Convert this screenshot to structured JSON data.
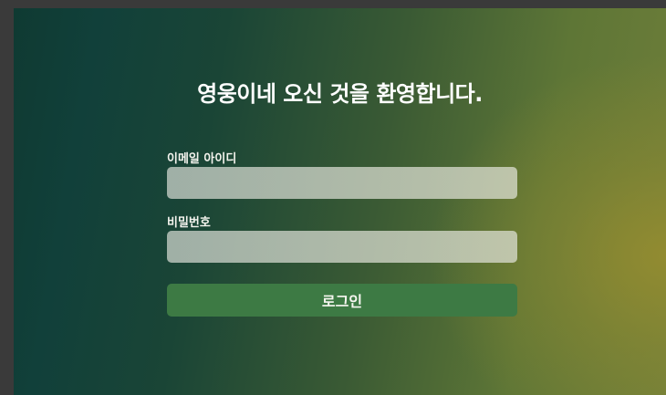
{
  "login": {
    "title": "영웅이네 오신 것을 환영합니다.",
    "email_label": "이메일 아이디",
    "email_value": "",
    "password_label": "비밀번호",
    "password_value": "",
    "button_label": "로그인"
  },
  "colors": {
    "button_bg": "#3d7a44",
    "bg_dark": "#0f3a32",
    "bg_olive": "#948c30"
  }
}
